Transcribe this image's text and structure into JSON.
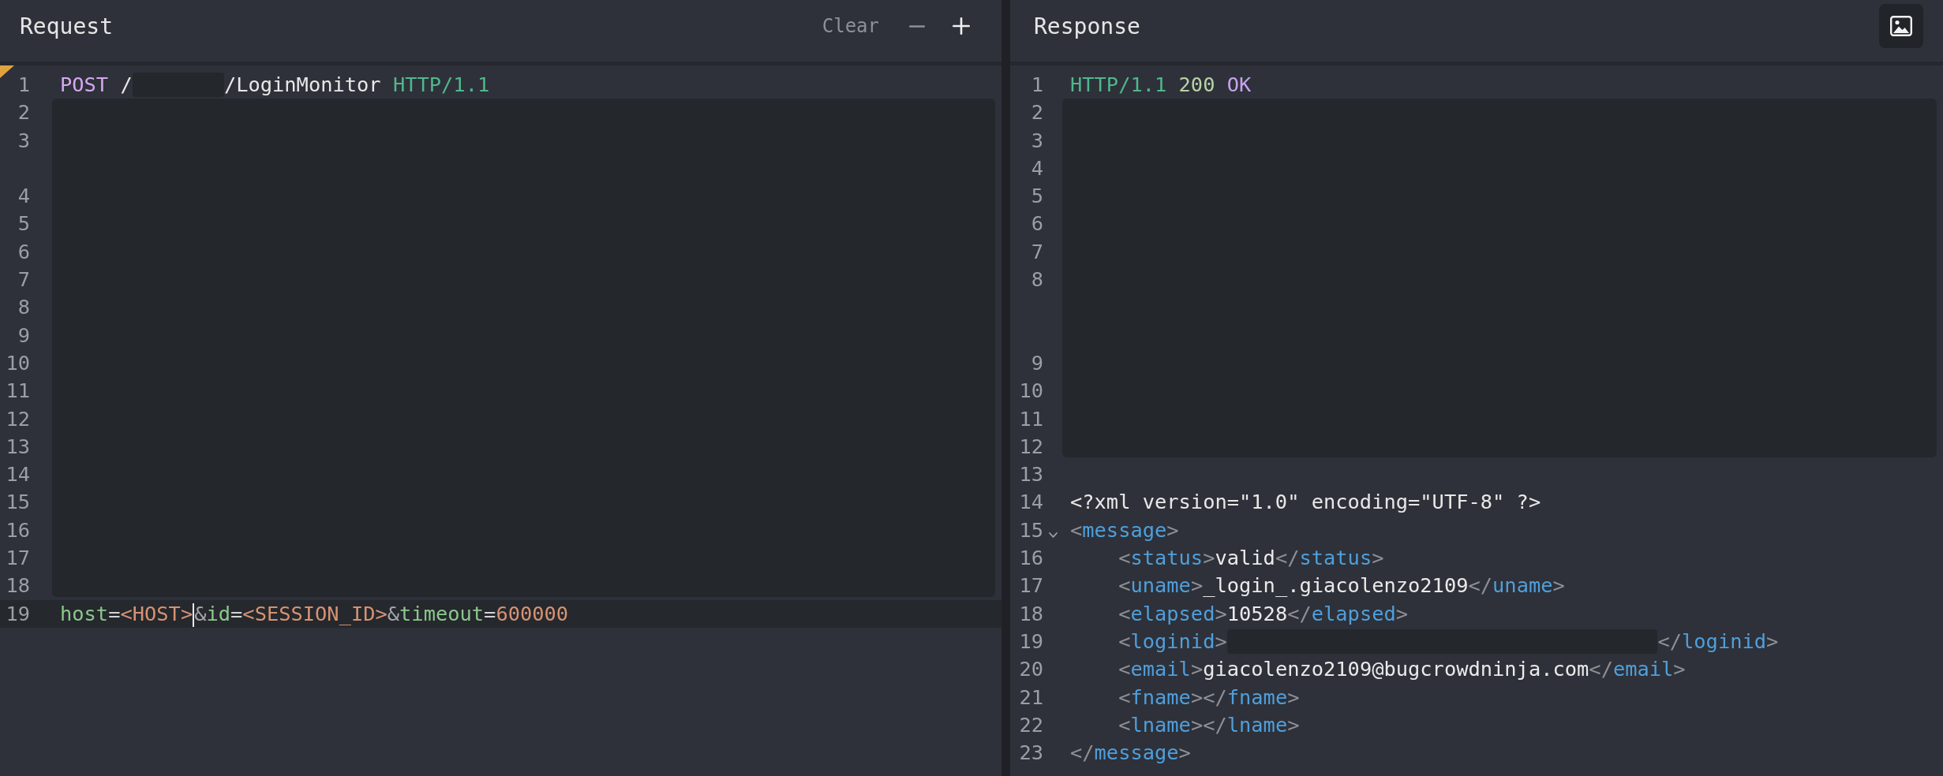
{
  "panels": [
    {
      "title": "Request",
      "flagged": true,
      "actions": [
        {
          "kind": "clear",
          "label": "Clear",
          "disabled": false
        },
        {
          "kind": "minus",
          "disabled": true
        },
        {
          "kind": "plus",
          "disabled": false
        }
      ],
      "editor": [
        {
          "kind": "line",
          "number": "1",
          "current": false,
          "tokens": [
            {
              "kind": "method",
              "text": "POST"
            },
            {
              "kind": "plain",
              "text": " /"
            },
            {
              "kind": "redacted"
            },
            {
              "kind": "plain",
              "text": "/LoginMonitor "
            },
            {
              "kind": "version",
              "text": "HTTP/1.1"
            }
          ]
        },
        {
          "kind": "redacted",
          "rows": [
            {
              "kind": "line",
              "number": "2"
            },
            {
              "kind": "line",
              "number": "3"
            },
            {
              "kind": "wrap"
            },
            {
              "kind": "line",
              "number": "4"
            },
            {
              "kind": "line",
              "number": "5"
            },
            {
              "kind": "line",
              "number": "6"
            },
            {
              "kind": "line",
              "number": "7"
            },
            {
              "kind": "line",
              "number": "8"
            },
            {
              "kind": "line",
              "number": "9"
            },
            {
              "kind": "line",
              "number": "10"
            },
            {
              "kind": "line",
              "number": "11"
            },
            {
              "kind": "line",
              "number": "12"
            },
            {
              "kind": "line",
              "number": "13"
            },
            {
              "kind": "line",
              "number": "14"
            },
            {
              "kind": "line",
              "number": "15"
            },
            {
              "kind": "line",
              "number": "16"
            },
            {
              "kind": "line",
              "number": "17"
            },
            {
              "kind": "line",
              "number": "18"
            }
          ]
        },
        {
          "kind": "line",
          "number": "19",
          "current": true,
          "tokens": [
            {
              "kind": "param",
              "text": "host"
            },
            {
              "kind": "op",
              "text": "="
            },
            {
              "kind": "value",
              "text": "<HOST>"
            },
            {
              "kind": "cursor"
            },
            {
              "kind": "amp",
              "text": "&"
            },
            {
              "kind": "param",
              "text": "id"
            },
            {
              "kind": "op",
              "text": "="
            },
            {
              "kind": "value",
              "text": "<SESSION_ID>"
            },
            {
              "kind": "amp",
              "text": "&"
            },
            {
              "kind": "param",
              "text": "timeout"
            },
            {
              "kind": "op",
              "text": "="
            },
            {
              "kind": "value",
              "text": "600000"
            }
          ]
        }
      ]
    },
    {
      "title": "Response",
      "flagged": false,
      "actions": [
        {
          "kind": "image",
          "disabled": false
        }
      ],
      "editor": [
        {
          "kind": "line",
          "number": "1",
          "current": false,
          "tokens": [
            {
              "kind": "version",
              "text": "HTTP/1.1 "
            },
            {
              "kind": "status",
              "text": "200 "
            },
            {
              "kind": "reason",
              "text": "OK"
            }
          ]
        },
        {
          "kind": "redacted",
          "rows": [
            {
              "kind": "line",
              "number": "2"
            },
            {
              "kind": "line",
              "number": "3"
            },
            {
              "kind": "line",
              "number": "4"
            },
            {
              "kind": "line",
              "number": "5"
            },
            {
              "kind": "line",
              "number": "6"
            },
            {
              "kind": "line",
              "number": "7"
            },
            {
              "kind": "line",
              "number": "8"
            },
            {
              "kind": "wrap"
            },
            {
              "kind": "wrap"
            },
            {
              "kind": "line",
              "number": "9"
            },
            {
              "kind": "line",
              "number": "10"
            },
            {
              "kind": "line",
              "number": "11"
            },
            {
              "kind": "line",
              "number": "12"
            }
          ]
        },
        {
          "kind": "line",
          "number": "13",
          "current": false
        },
        {
          "kind": "line",
          "number": "14",
          "current": false,
          "tokens": [
            {
              "kind": "plain",
              "text": "<?xml version=\"1.0\" encoding=\"UTF-8\" ?>"
            }
          ]
        },
        {
          "kind": "line",
          "number": "15",
          "current": false,
          "expanded": true,
          "tokens": [
            {
              "kind": "bracket",
              "text": "<"
            },
            {
              "kind": "tag",
              "text": "message"
            },
            {
              "kind": "bracket",
              "text": ">"
            }
          ],
          "children": [
            {
              "kind": "line",
              "number": "16",
              "current": false,
              "tokens": [
                {
                  "kind": "bracket",
                  "text": "<"
                },
                {
                  "kind": "tag",
                  "text": "status"
                },
                {
                  "kind": "bracket",
                  "text": ">"
                },
                {
                  "kind": "text",
                  "text": "valid"
                },
                {
                  "kind": "bracket",
                  "text": "</"
                },
                {
                  "kind": "tag",
                  "text": "status"
                },
                {
                  "kind": "bracket",
                  "text": ">"
                }
              ]
            },
            {
              "kind": "line",
              "number": "17",
              "current": false,
              "tokens": [
                {
                  "kind": "bracket",
                  "text": "<"
                },
                {
                  "kind": "tag",
                  "text": "uname"
                },
                {
                  "kind": "bracket",
                  "text": ">"
                },
                {
                  "kind": "text",
                  "text": "_login_.giacolenzo2109"
                },
                {
                  "kind": "bracket",
                  "text": "</"
                },
                {
                  "kind": "tag",
                  "text": "uname"
                },
                {
                  "kind": "bracket",
                  "text": ">"
                }
              ]
            },
            {
              "kind": "line",
              "number": "18",
              "current": false,
              "tokens": [
                {
                  "kind": "bracket",
                  "text": "<"
                },
                {
                  "kind": "tag",
                  "text": "elapsed"
                },
                {
                  "kind": "bracket",
                  "text": ">"
                },
                {
                  "kind": "text",
                  "text": "10528"
                },
                {
                  "kind": "bracket",
                  "text": "</"
                },
                {
                  "kind": "tag",
                  "text": "elapsed"
                },
                {
                  "kind": "bracket",
                  "text": ">"
                }
              ]
            },
            {
              "kind": "line",
              "number": "19",
              "current": false,
              "tokens": [
                {
                  "kind": "bracket",
                  "text": "<"
                },
                {
                  "kind": "tag",
                  "text": "loginid"
                },
                {
                  "kind": "bracket",
                  "text": ">"
                },
                {
                  "kind": "redacted"
                },
                {
                  "kind": "bracket",
                  "text": "</"
                },
                {
                  "kind": "tag",
                  "text": "loginid"
                },
                {
                  "kind": "bracket",
                  "text": ">"
                }
              ]
            },
            {
              "kind": "line",
              "number": "20",
              "current": false,
              "tokens": [
                {
                  "kind": "bracket",
                  "text": "<"
                },
                {
                  "kind": "tag",
                  "text": "email"
                },
                {
                  "kind": "bracket",
                  "text": ">"
                },
                {
                  "kind": "text",
                  "text": "giacolenzo2109@bugcrowdninja.com"
                },
                {
                  "kind": "bracket",
                  "text": "</"
                },
                {
                  "kind": "tag",
                  "text": "email"
                },
                {
                  "kind": "bracket",
                  "text": ">"
                }
              ]
            },
            {
              "kind": "line",
              "number": "21",
              "current": false,
              "tokens": [
                {
                  "kind": "bracket",
                  "text": "<"
                },
                {
                  "kind": "tag",
                  "text": "fname"
                },
                {
                  "kind": "bracket",
                  "text": "></"
                },
                {
                  "kind": "tag",
                  "text": "fname"
                },
                {
                  "kind": "bracket",
                  "text": ">"
                }
              ]
            },
            {
              "kind": "line",
              "number": "22",
              "current": false,
              "tokens": [
                {
                  "kind": "bracket",
                  "text": "<"
                },
                {
                  "kind": "tag",
                  "text": "lname"
                },
                {
                  "kind": "bracket",
                  "text": "></"
                },
                {
                  "kind": "tag",
                  "text": "lname"
                },
                {
                  "kind": "bracket",
                  "text": ">"
                }
              ]
            }
          ]
        },
        {
          "kind": "line",
          "number": "23",
          "current": false,
          "tokens": [
            {
              "kind": "bracket",
              "text": "</"
            },
            {
              "kind": "tag",
              "text": "message"
            },
            {
              "kind": "bracket",
              "text": ">"
            }
          ]
        }
      ]
    }
  ]
}
